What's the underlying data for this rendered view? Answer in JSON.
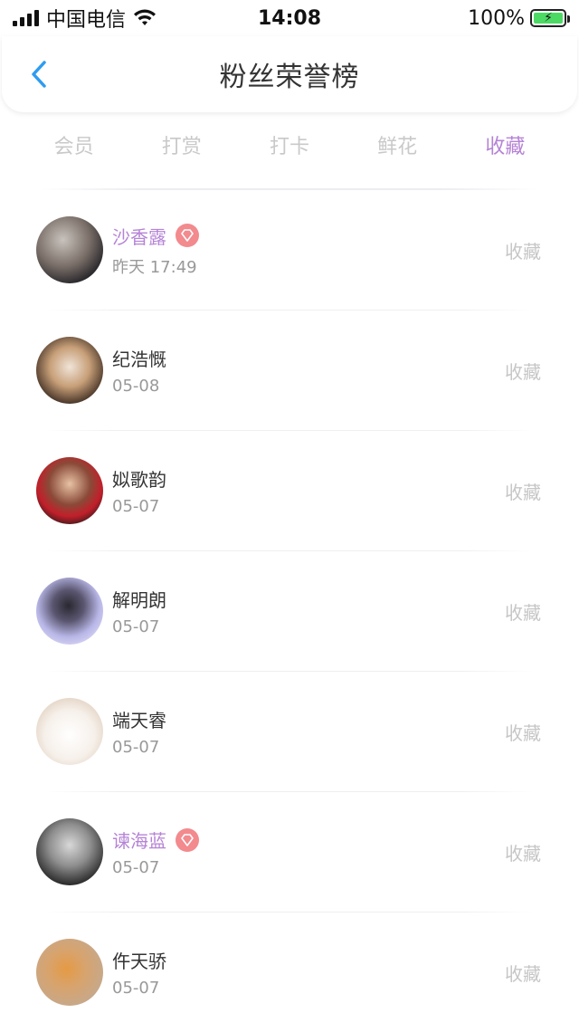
{
  "status_bar": {
    "carrier": "中国电信",
    "time": "14:08",
    "battery_percent": "100%",
    "battery_level": 1.0
  },
  "header": {
    "title": "粉丝荣誉榜",
    "back_icon": "chevron-left-icon"
  },
  "colors": {
    "accent": "#b583d6",
    "badge": "#f28a8e",
    "back": "#2e9cf0",
    "inactive_tab": "#c9c9c9"
  },
  "tabs": [
    {
      "label": "会员",
      "active": false
    },
    {
      "label": "打赏",
      "active": false
    },
    {
      "label": "打卡",
      "active": false
    },
    {
      "label": "鲜花",
      "active": false
    },
    {
      "label": "收藏",
      "active": true
    }
  ],
  "fans": [
    {
      "name": "沙香露",
      "date": "昨天 17:49",
      "action": "收藏",
      "vip": true
    },
    {
      "name": "纪浩慨",
      "date": "05-08",
      "action": "收藏",
      "vip": false
    },
    {
      "name": "姒歌韵",
      "date": "05-07",
      "action": "收藏",
      "vip": false
    },
    {
      "name": "解明朗",
      "date": "05-07",
      "action": "收藏",
      "vip": false
    },
    {
      "name": "端天睿",
      "date": "05-07",
      "action": "收藏",
      "vip": false
    },
    {
      "name": "谏海蓝",
      "date": "05-07",
      "action": "收藏",
      "vip": true
    },
    {
      "name": "仵天骄",
      "date": "05-07",
      "action": "收藏",
      "vip": false
    }
  ]
}
